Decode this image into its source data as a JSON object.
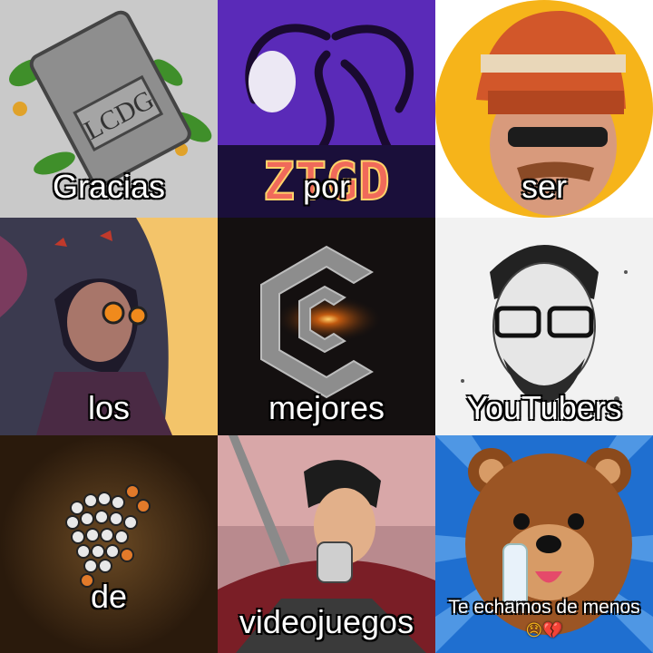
{
  "tiles": [
    {
      "caption": "Gracias",
      "avatar": "memory-card-avatar",
      "card_text": "LCDG"
    },
    {
      "caption": "por",
      "avatar": "ztgd-logo-avatar",
      "logo_text": "ZTGD"
    },
    {
      "caption": "ser",
      "avatar": "beanie-sunglasses-man-avatar"
    },
    {
      "caption": "los",
      "avatar": "illustrated-character-avatar"
    },
    {
      "caption": "mejores",
      "avatar": "c-logo-avatar"
    },
    {
      "caption": "YouTubers",
      "avatar": "sketch-portrait-avatar"
    },
    {
      "caption": "de",
      "avatar": "bead-pixel-art-avatar"
    },
    {
      "caption": "videojuegos",
      "avatar": "anime-swordsman-avatar"
    },
    {
      "caption": "Te echamos de menos",
      "emoji": "😞💔",
      "avatar": "bear-mascot-avatar"
    }
  ],
  "colors": {
    "caption_text": "#ffffff",
    "caption_outline": "#000000",
    "ztgd_purple": "#5a2ab8",
    "ser_yellow": "#f6b41a",
    "bear_blue": "#1f6fd0"
  }
}
